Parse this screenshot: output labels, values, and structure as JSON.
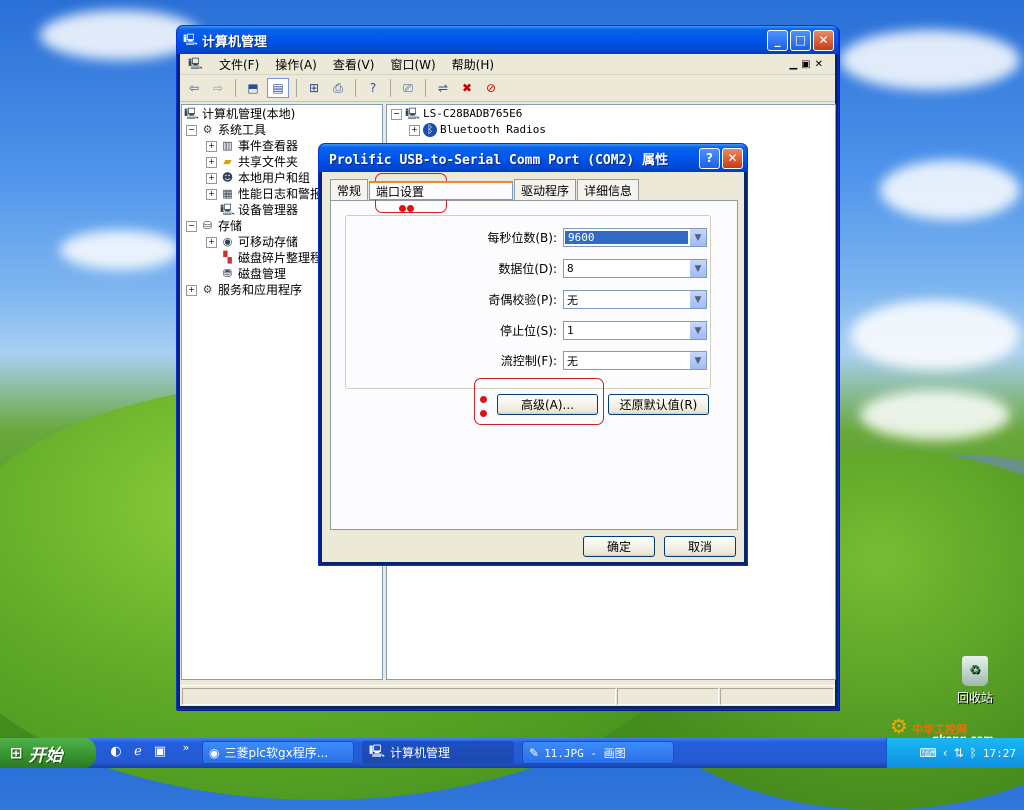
{
  "main_window": {
    "title": "计算机管理",
    "menu": [
      "文件(F)",
      "操作(A)",
      "查看(V)",
      "窗口(W)",
      "帮助(H)"
    ],
    "tree": {
      "root": "计算机管理(本地)",
      "items": [
        {
          "label": "系统工具"
        },
        {
          "label": "事件查看器"
        },
        {
          "label": "共享文件夹"
        },
        {
          "label": "本地用户和组"
        },
        {
          "label": "性能日志和警报"
        },
        {
          "label": "设备管理器"
        },
        {
          "label": "存储"
        },
        {
          "label": "可移动存储"
        },
        {
          "label": "磁盘碎片整理程序"
        },
        {
          "label": "磁盘管理"
        },
        {
          "label": "服务和应用程序"
        }
      ]
    },
    "right_tree": {
      "computer": "LS-C28BADB765E6",
      "child": "Bluetooth Radios"
    }
  },
  "dialog": {
    "title": "Prolific USB-to-Serial Comm Port (COM2) 属性",
    "tabs": [
      "常规",
      "端口设置",
      "驱动程序",
      "详细信息"
    ],
    "selected_tab": "端口设置",
    "fields": [
      {
        "label": "每秒位数(B):",
        "value": "9600"
      },
      {
        "label": "数据位(D):",
        "value": "8"
      },
      {
        "label": "奇偶校验(P):",
        "value": "无"
      },
      {
        "label": "停止位(S):",
        "value": "1"
      },
      {
        "label": "流控制(F):",
        "value": "无"
      }
    ],
    "advanced_button": "高级(A)...",
    "restore_button": "还原默认值(R)",
    "ok_button": "确定",
    "cancel_button": "取消"
  },
  "desktop": {
    "recycle_bin": "回收站",
    "watermark": "中华工控网",
    "watermark_sub": "gkong.com"
  },
  "taskbar": {
    "start": "开始",
    "tasks": [
      "三菱plc软gx程序...",
      "计算机管理",
      "11.JPG - 画图"
    ],
    "clock": "17:27"
  },
  "colors": {
    "annotation_red": "#d0202a",
    "xp_blue": "#0058ee",
    "selection": "#316ac5"
  }
}
